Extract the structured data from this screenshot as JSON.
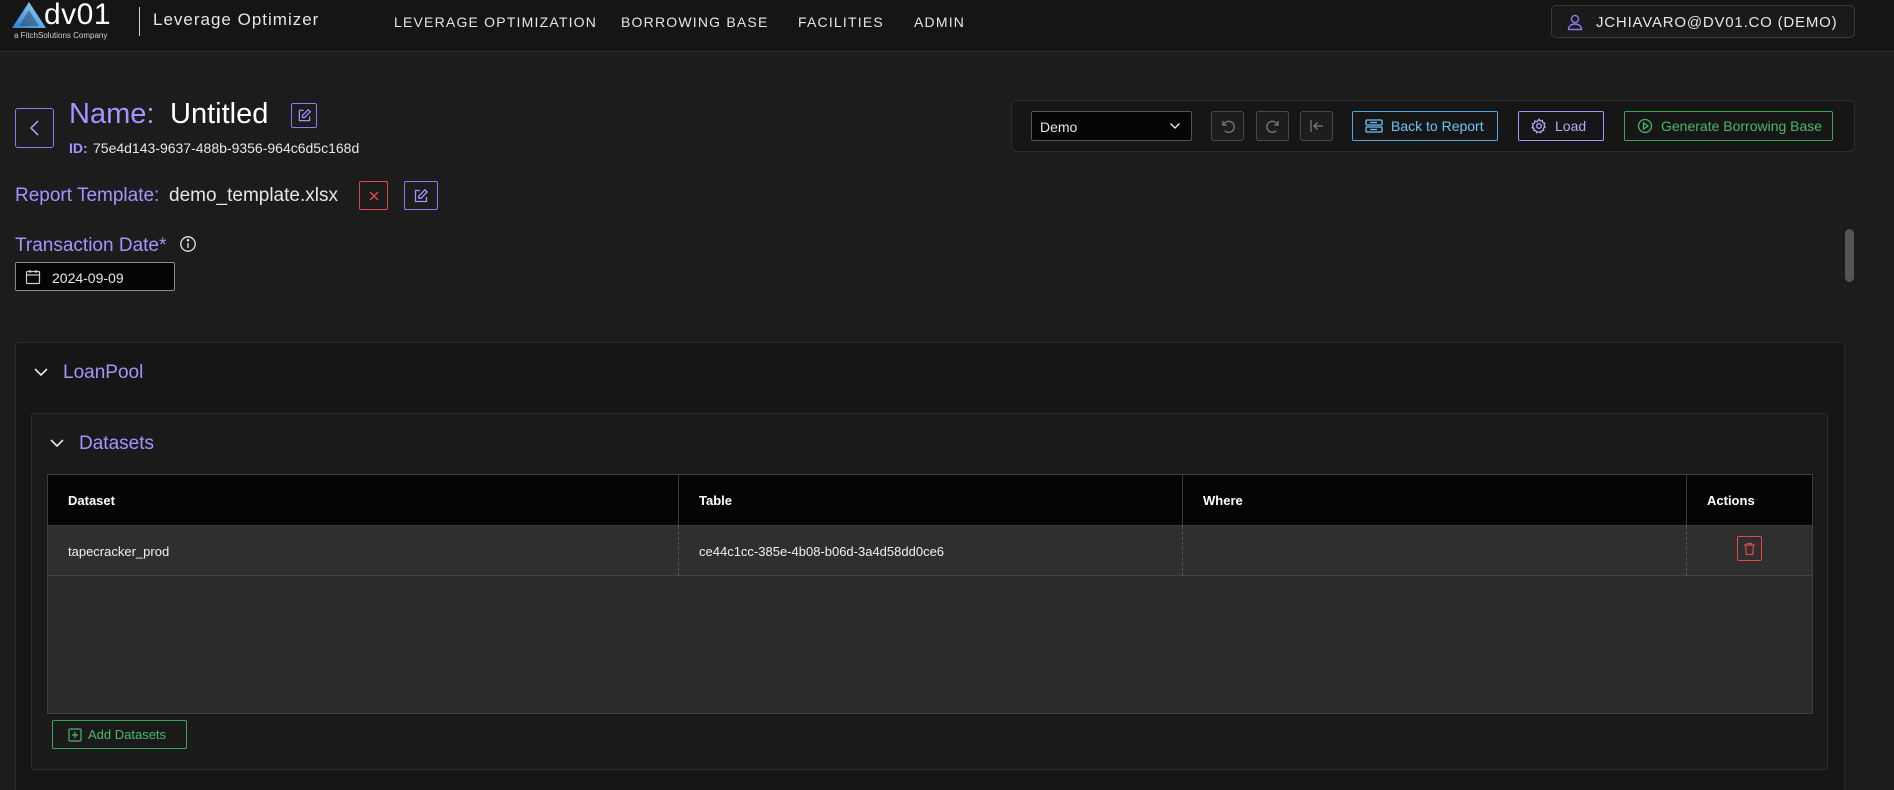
{
  "brand": {
    "logo_text": "dv01",
    "logo_subtext": "a FitchSolutions Company",
    "app_name": "Leverage Optimizer"
  },
  "nav": {
    "items": [
      {
        "label": "LEVERAGE OPTIMIZATION"
      },
      {
        "label": "BORROWING BASE"
      },
      {
        "label": "FACILITIES"
      },
      {
        "label": "ADMIN"
      }
    ]
  },
  "user": {
    "label": "JCHIAVARO@DV01.CO (DEMO)"
  },
  "header": {
    "name_label": "Name:",
    "name_value": "Untitled",
    "id_label": "ID:",
    "id_value": "75e4d143-9637-488b-9356-964c6d5c168d"
  },
  "toolbar": {
    "environment_select": "Demo",
    "back_to_report": "Back to Report",
    "load": "Load",
    "generate": "Generate Borrowing Base"
  },
  "report_template": {
    "label": "Report Template:",
    "value": "demo_template.xlsx"
  },
  "transaction_date": {
    "label": "Transaction Date*",
    "value": "2024-09-09"
  },
  "loan_pool": {
    "title": "LoanPool",
    "datasets": {
      "title": "Datasets",
      "columns": [
        "Dataset",
        "Table",
        "Where",
        "Actions"
      ],
      "rows": [
        {
          "dataset": "tapecracker_prod",
          "table": "ce44c1cc-385e-4b08-b06d-3a4d58dd0ce6",
          "where": ""
        }
      ],
      "add_label": "Add Datasets"
    }
  },
  "colors": {
    "accent_purple": "#a892ff",
    "accent_blue": "#4aa8e0",
    "accent_green": "#3aa655",
    "danger_red": "#e0484d",
    "background": "#1c1c1d"
  },
  "icons": [
    "user-icon",
    "chevron-left-icon",
    "edit-icon",
    "chevron-down-icon",
    "undo-icon",
    "redo-icon",
    "collapse-left-icon",
    "report-icon",
    "gear-icon",
    "play-icon",
    "close-icon",
    "info-icon",
    "calendar-icon",
    "trash-icon",
    "plus-square-icon"
  ]
}
